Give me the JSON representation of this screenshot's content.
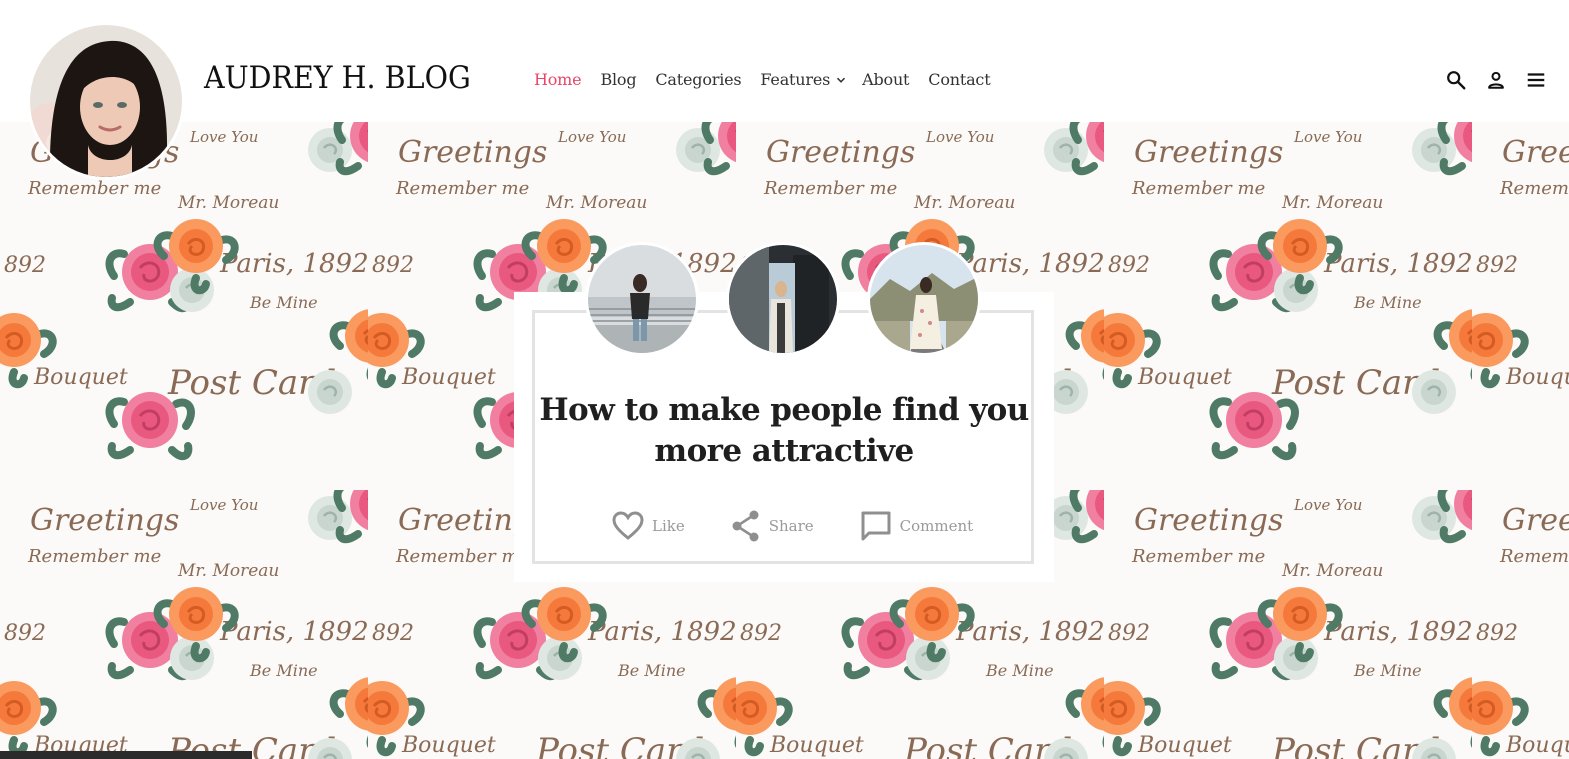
{
  "site": {
    "title": "AUDREY H. BLOG"
  },
  "nav": {
    "items": [
      {
        "label": "Home",
        "active": true
      },
      {
        "label": "Blog"
      },
      {
        "label": "Categories"
      },
      {
        "label": "Features",
        "has_dropdown": true
      },
      {
        "label": "About"
      },
      {
        "label": "Contact"
      }
    ]
  },
  "tools": {
    "icons": [
      "search-icon",
      "user-icon",
      "menu-icon"
    ]
  },
  "featured_post": {
    "title": "How to make people find you more attractive",
    "actions": {
      "like": "Like",
      "share": "Share",
      "comment": "Comment"
    }
  },
  "colors": {
    "accent": "#e8466a",
    "muted": "#9a9a9a",
    "script_brown": "#8a6a55"
  }
}
